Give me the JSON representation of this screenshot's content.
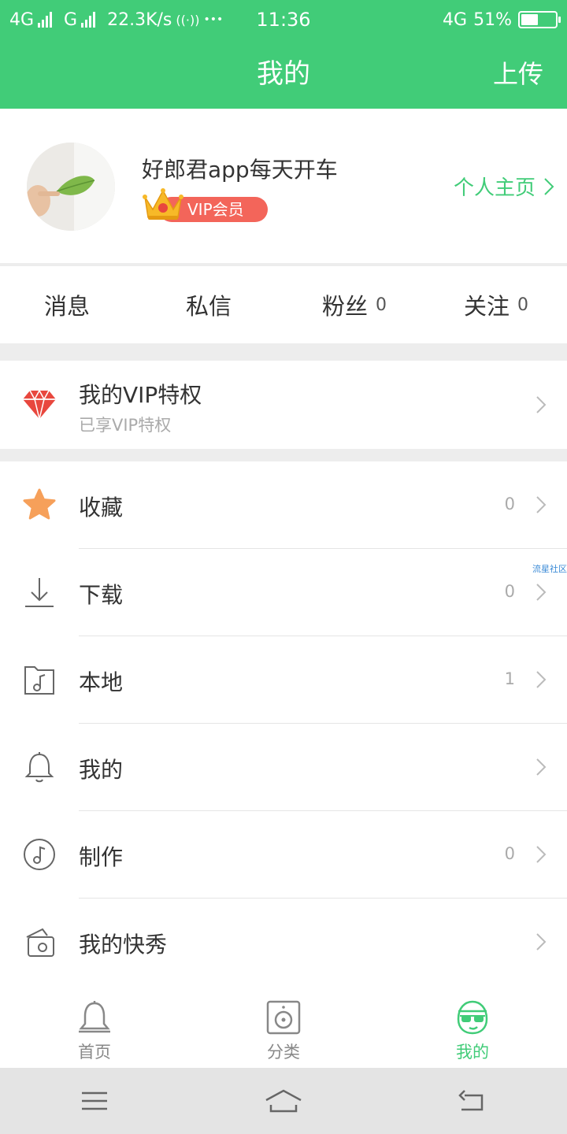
{
  "status_bar": {
    "network1": "4G",
    "network2": "G",
    "speed": "22.3K/s",
    "hotspot": "((·))",
    "dots": "•••",
    "time": "11:36",
    "network3": "4G",
    "battery": "51%",
    "battery_level": 0.51
  },
  "header": {
    "title": "我的",
    "upload": "上传"
  },
  "profile": {
    "username": "好郎君app每天开车",
    "vip_badge": "VIP会员",
    "homepage_link": "个人主页"
  },
  "stats": [
    {
      "label": "消息",
      "count": ""
    },
    {
      "label": "私信",
      "count": ""
    },
    {
      "label": "粉丝",
      "count": "0"
    },
    {
      "label": "关注",
      "count": "0"
    }
  ],
  "vip_privilege": {
    "title": "我的VIP特权",
    "subtitle": "已享VIP特权"
  },
  "menu": [
    {
      "label": "收藏",
      "count": "0",
      "icon": "star-icon"
    },
    {
      "label": "下载",
      "count": "0",
      "icon": "download-icon"
    },
    {
      "label": "本地",
      "count": "1",
      "icon": "local-music-folder-icon"
    },
    {
      "label": "我的",
      "count": "",
      "icon": "bell-icon"
    },
    {
      "label": "制作",
      "count": "0",
      "icon": "music-note-icon"
    },
    {
      "label": "我的快秀",
      "count": "",
      "icon": "video-show-icon"
    }
  ],
  "watermark": "流星社区",
  "tabs": [
    {
      "label": "首页",
      "icon": "bell-home-icon",
      "active": false
    },
    {
      "label": "分类",
      "icon": "speaker-icon",
      "active": false
    },
    {
      "label": "我的",
      "icon": "sunglasses-face-icon",
      "active": true
    }
  ],
  "colors": {
    "primary": "#41cc78",
    "vip_badge": "#f3655a",
    "gem": "#e8473e",
    "star": "#f6a05a"
  }
}
